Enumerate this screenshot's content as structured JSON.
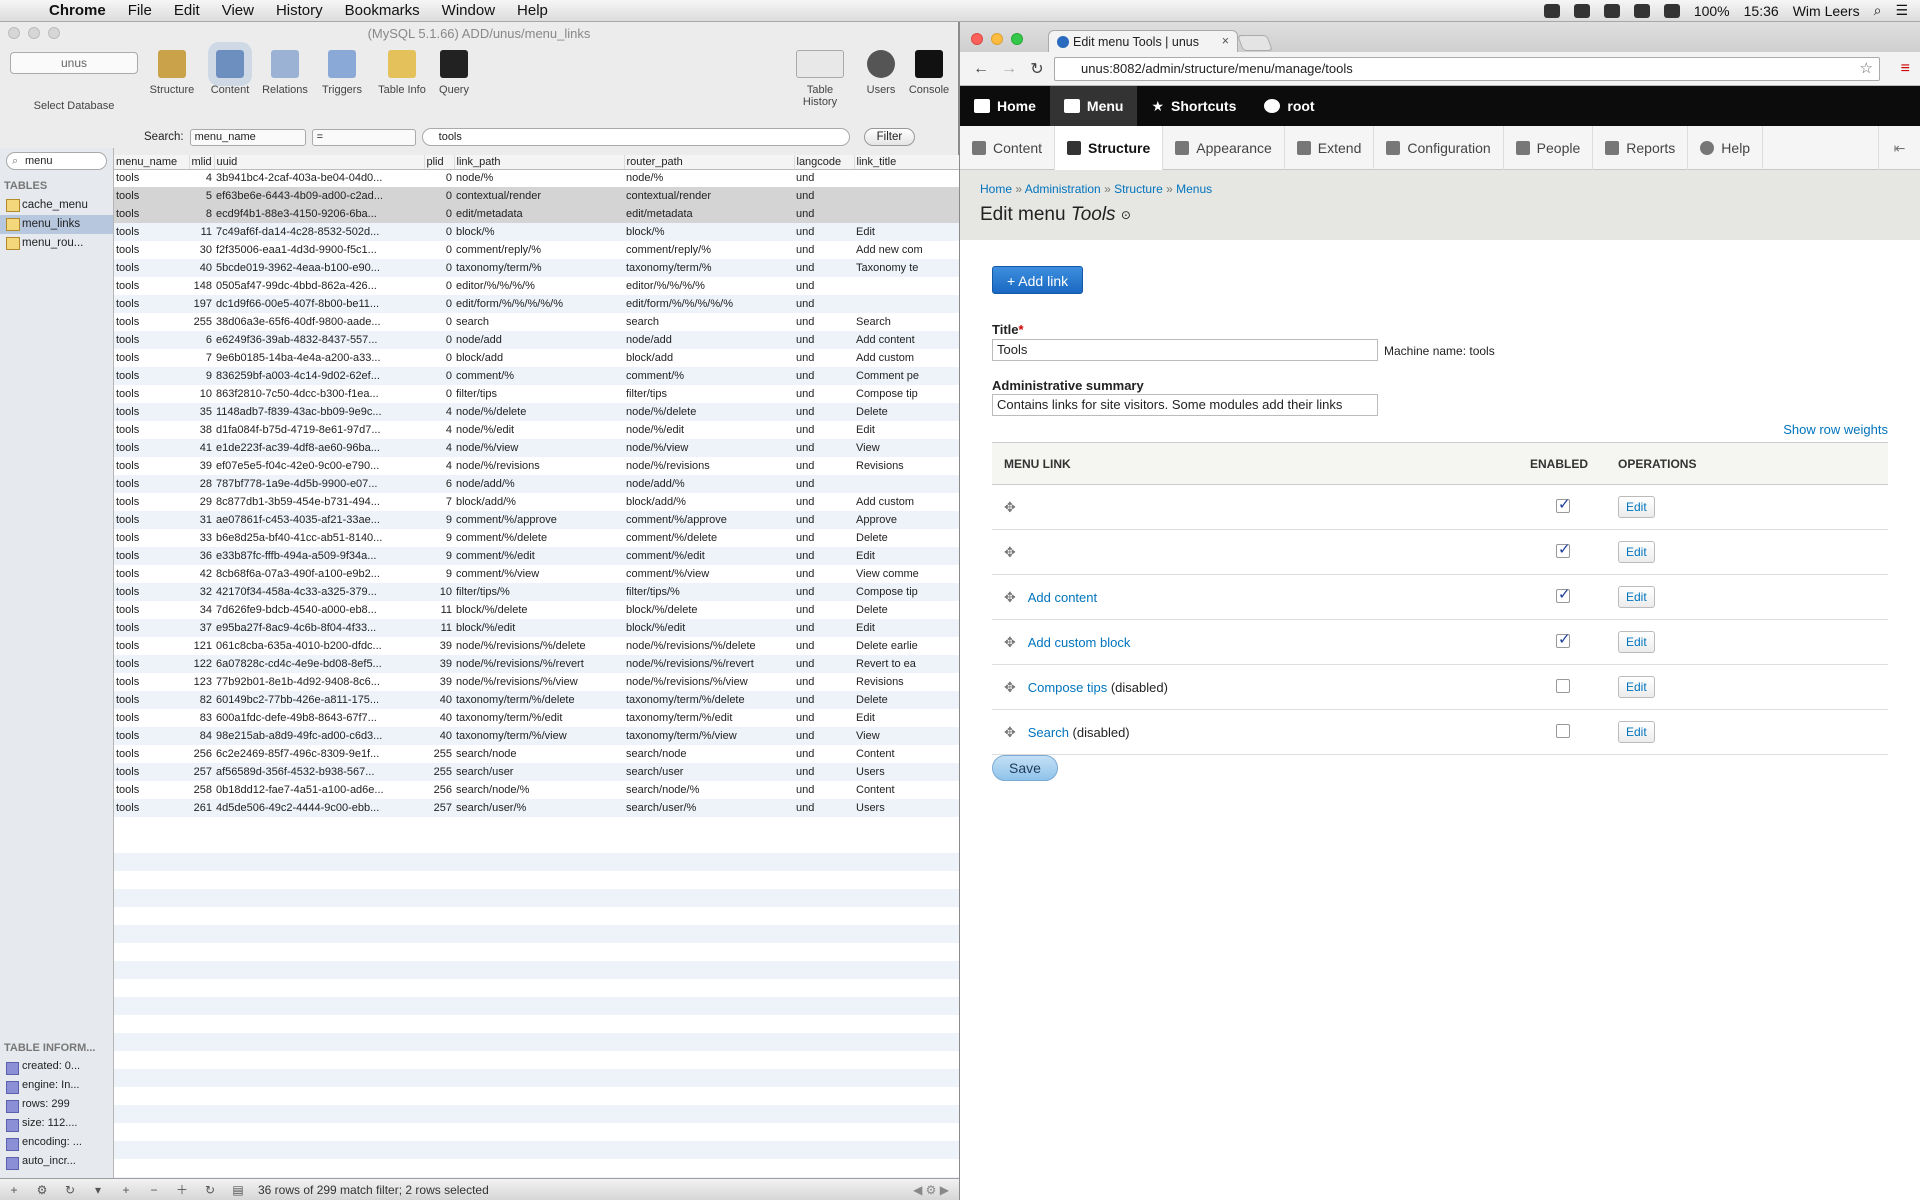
{
  "menubar": {
    "app": "Chrome",
    "items": [
      "File",
      "Edit",
      "View",
      "History",
      "Bookmarks",
      "Window",
      "Help"
    ],
    "battery": "100%",
    "time": "15:36",
    "user": "Wim Leers"
  },
  "sequel": {
    "title": "(MySQL 5.1.66) ADD/unus/menu_links",
    "database": "unus",
    "select_db_label": "Select Database",
    "toolbar": [
      "Structure",
      "Content",
      "Relations",
      "Triggers",
      "Table Info",
      "Query"
    ],
    "toolbar_right": [
      "Table History",
      "Users",
      "Console"
    ],
    "table_filter": "menu",
    "tables_header": "TABLES",
    "tables": [
      "cache_menu",
      "menu_links",
      "menu_rou..."
    ],
    "search_label": "Search:",
    "search_field": "menu_name",
    "search_op": "=",
    "search_value": "tools",
    "filter_btn": "Filter",
    "columns": [
      "menu_name",
      "mlid",
      "uuid",
      "plid",
      "link_path",
      "router_path",
      "langcode",
      "link_title"
    ],
    "rows": [
      [
        "tools",
        "4",
        "3b941bc4-2caf-403a-be04-04d0...",
        "0",
        "node/%",
        "node/%",
        "und",
        ""
      ],
      [
        "tools",
        "5",
        "ef63be6e-6443-4b09-ad00-c2ad...",
        "0",
        "contextual/render",
        "contextual/render",
        "und",
        ""
      ],
      [
        "tools",
        "8",
        "ecd9f4b1-88e3-4150-9206-6ba...",
        "0",
        "edit/metadata",
        "edit/metadata",
        "und",
        ""
      ],
      [
        "tools",
        "11",
        "7c49af6f-da14-4c28-8532-502d...",
        "0",
        "block/%",
        "block/%",
        "und",
        "Edit"
      ],
      [
        "tools",
        "30",
        "f2f35006-eaa1-4d3d-9900-f5c1...",
        "0",
        "comment/reply/%",
        "comment/reply/%",
        "und",
        "Add new com"
      ],
      [
        "tools",
        "40",
        "5bcde019-3962-4eaa-b100-e90...",
        "0",
        "taxonomy/term/%",
        "taxonomy/term/%",
        "und",
        "Taxonomy te"
      ],
      [
        "tools",
        "148",
        "0505af47-99dc-4bbd-862a-426...",
        "0",
        "editor/%/%/%/%",
        "editor/%/%/%/%",
        "und",
        ""
      ],
      [
        "tools",
        "197",
        "dc1d9f66-00e5-407f-8b00-be11...",
        "0",
        "edit/form/%/%/%/%/%",
        "edit/form/%/%/%/%/%",
        "und",
        ""
      ],
      [
        "tools",
        "255",
        "38d06a3e-65f6-40df-9800-aade...",
        "0",
        "search",
        "search",
        "und",
        "Search"
      ],
      [
        "tools",
        "6",
        "e6249f36-39ab-4832-8437-557...",
        "0",
        "node/add",
        "node/add",
        "und",
        "Add content"
      ],
      [
        "tools",
        "7",
        "9e6b0185-14ba-4e4a-a200-a33...",
        "0",
        "block/add",
        "block/add",
        "und",
        "Add custom"
      ],
      [
        "tools",
        "9",
        "836259bf-a003-4c14-9d02-62ef...",
        "0",
        "comment/%",
        "comment/%",
        "und",
        "Comment pe"
      ],
      [
        "tools",
        "10",
        "863f2810-7c50-4dcc-b300-f1ea...",
        "0",
        "filter/tips",
        "filter/tips",
        "und",
        "Compose tip"
      ],
      [
        "tools",
        "35",
        "1148adb7-f839-43ac-bb09-9e9c...",
        "4",
        "node/%/delete",
        "node/%/delete",
        "und",
        "Delete"
      ],
      [
        "tools",
        "38",
        "d1fa084f-b75d-4719-8e61-97d7...",
        "4",
        "node/%/edit",
        "node/%/edit",
        "und",
        "Edit"
      ],
      [
        "tools",
        "41",
        "e1de223f-ac39-4df8-ae60-96ba...",
        "4",
        "node/%/view",
        "node/%/view",
        "und",
        "View"
      ],
      [
        "tools",
        "39",
        "ef07e5e5-f04c-42e0-9c00-e790...",
        "4",
        "node/%/revisions",
        "node/%/revisions",
        "und",
        "Revisions"
      ],
      [
        "tools",
        "28",
        "787bf778-1a9e-4d5b-9900-e07...",
        "6",
        "node/add/%",
        "node/add/%",
        "und",
        ""
      ],
      [
        "tools",
        "29",
        "8c877db1-3b59-454e-b731-494...",
        "7",
        "block/add/%",
        "block/add/%",
        "und",
        "Add custom"
      ],
      [
        "tools",
        "31",
        "ae07861f-c453-4035-af21-33ae...",
        "9",
        "comment/%/approve",
        "comment/%/approve",
        "und",
        "Approve"
      ],
      [
        "tools",
        "33",
        "b6e8d25a-bf40-41cc-ab51-8140...",
        "9",
        "comment/%/delete",
        "comment/%/delete",
        "und",
        "Delete"
      ],
      [
        "tools",
        "36",
        "e33b87fc-fffb-494a-a509-9f34a...",
        "9",
        "comment/%/edit",
        "comment/%/edit",
        "und",
        "Edit"
      ],
      [
        "tools",
        "42",
        "8cb68f6a-07a3-490f-a100-e9b2...",
        "9",
        "comment/%/view",
        "comment/%/view",
        "und",
        "View comme"
      ],
      [
        "tools",
        "32",
        "42170f34-458a-4c33-a325-379...",
        "10",
        "filter/tips/%",
        "filter/tips/%",
        "und",
        "Compose tip"
      ],
      [
        "tools",
        "34",
        "7d626fe9-bdcb-4540-a000-eb8...",
        "11",
        "block/%/delete",
        "block/%/delete",
        "und",
        "Delete"
      ],
      [
        "tools",
        "37",
        "e95ba27f-8ac9-4c6b-8f04-4f33...",
        "11",
        "block/%/edit",
        "block/%/edit",
        "und",
        "Edit"
      ],
      [
        "tools",
        "121",
        "061c8cba-635a-4010-b200-dfdc...",
        "39",
        "node/%/revisions/%/delete",
        "node/%/revisions/%/delete",
        "und",
        "Delete earlie"
      ],
      [
        "tools",
        "122",
        "6a07828c-cd4c-4e9e-bd08-8ef5...",
        "39",
        "node/%/revisions/%/revert",
        "node/%/revisions/%/revert",
        "und",
        "Revert to ea"
      ],
      [
        "tools",
        "123",
        "77b92b01-8e1b-4d92-9408-8c6...",
        "39",
        "node/%/revisions/%/view",
        "node/%/revisions/%/view",
        "und",
        "Revisions"
      ],
      [
        "tools",
        "82",
        "60149bc2-77bb-426e-a811-175...",
        "40",
        "taxonomy/term/%/delete",
        "taxonomy/term/%/delete",
        "und",
        "Delete"
      ],
      [
        "tools",
        "83",
        "600a1fdc-defe-49b8-8643-67f7...",
        "40",
        "taxonomy/term/%/edit",
        "taxonomy/term/%/edit",
        "und",
        "Edit"
      ],
      [
        "tools",
        "84",
        "98e215ab-a8d9-49fc-ad00-c6d3...",
        "40",
        "taxonomy/term/%/view",
        "taxonomy/term/%/view",
        "und",
        "View"
      ],
      [
        "tools",
        "256",
        "6c2e2469-85f7-496c-8309-9e1f...",
        "255",
        "search/node",
        "search/node",
        "und",
        "Content"
      ],
      [
        "tools",
        "257",
        "af56589d-356f-4532-b938-567...",
        "255",
        "search/user",
        "search/user",
        "und",
        "Users"
      ],
      [
        "tools",
        "258",
        "0b18dd12-fae7-4a51-a100-ad6e...",
        "256",
        "search/node/%",
        "search/node/%",
        "und",
        "Content"
      ],
      [
        "tools",
        "261",
        "4d5de506-49c2-4444-9c00-ebb...",
        "257",
        "search/user/%",
        "search/user/%",
        "und",
        "Users"
      ]
    ],
    "table_info_header": "TABLE INFORM...",
    "table_info": [
      "created: 0...",
      "engine: In...",
      "rows: 299",
      "size: 112....",
      "encoding: ...",
      "auto_incr..."
    ],
    "status": "36 rows of 299 match filter; 2 rows selected"
  },
  "chrome": {
    "tab_title": "Edit menu Tools | unus",
    "url": "unus:8082/admin/structure/menu/manage/tools"
  },
  "drupal": {
    "toolbar": [
      "Home",
      "Menu",
      "Shortcuts",
      "root"
    ],
    "tray": [
      "Content",
      "Structure",
      "Appearance",
      "Extend",
      "Configuration",
      "People",
      "Reports",
      "Help"
    ],
    "breadcrumb": [
      "Home",
      "Administration",
      "Structure",
      "Menus"
    ],
    "title_prefix": "Edit menu ",
    "title_name": "Tools",
    "add_link": "+ Add link",
    "title_label": "Title",
    "title_value": "Tools",
    "machine_name": "Machine name: tools",
    "summary_label": "Administrative summary",
    "summary_value": "Contains links for site visitors. Some modules add their links",
    "show_weights": "Show row weights",
    "col_link": "MENU LINK",
    "col_enabled": "ENABLED",
    "col_ops": "OPERATIONS",
    "links": [
      {
        "title": "",
        "suffix": "",
        "enabled": true,
        "op": "Edit"
      },
      {
        "title": "",
        "suffix": "",
        "enabled": true,
        "op": "Edit"
      },
      {
        "title": "Add content",
        "suffix": "",
        "enabled": true,
        "op": "Edit"
      },
      {
        "title": "Add custom block",
        "suffix": "",
        "enabled": true,
        "op": "Edit"
      },
      {
        "title": "Compose tips",
        "suffix": " (disabled)",
        "enabled": false,
        "op": "Edit"
      },
      {
        "title": "Search",
        "suffix": " (disabled)",
        "enabled": false,
        "op": "Edit"
      }
    ],
    "save": "Save"
  }
}
